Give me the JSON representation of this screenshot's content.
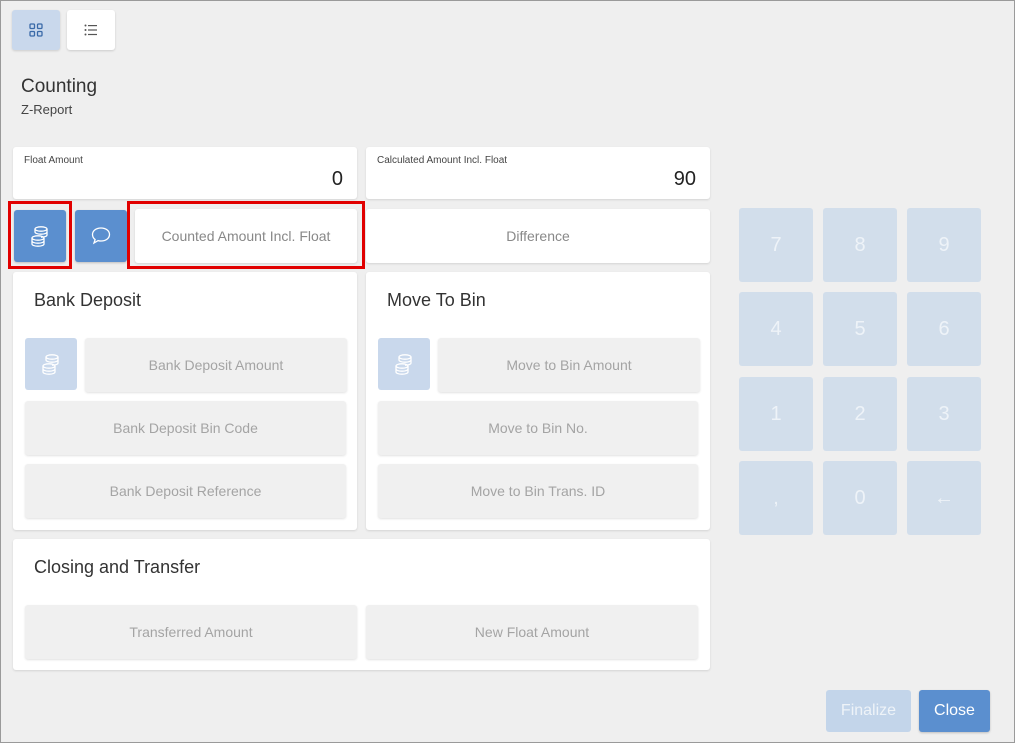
{
  "header": {
    "title": "Counting",
    "subtitle": "Z-Report"
  },
  "amounts": {
    "float_label": "Float Amount",
    "float_value": "0",
    "calculated_label": "Calculated Amount Incl. Float",
    "calculated_value": "90"
  },
  "counting": {
    "counted_label": "Counted Amount Incl. Float",
    "difference_label": "Difference"
  },
  "bank_deposit": {
    "title": "Bank Deposit",
    "amount_label": "Bank Deposit Amount",
    "bin_code_label": "Bank Deposit Bin Code",
    "reference_label": "Bank Deposit Reference"
  },
  "move_to_bin": {
    "title": "Move To Bin",
    "amount_label": "Move to Bin Amount",
    "bin_no_label": "Move to Bin No.",
    "trans_id_label": "Move to Bin Trans. ID"
  },
  "closing": {
    "title": "Closing and Transfer",
    "transferred_label": "Transferred Amount",
    "new_float_label": "New Float Amount"
  },
  "keypad": {
    "keys": [
      "7",
      "8",
      "9",
      "4",
      "5",
      "6",
      "1",
      "2",
      "3",
      ",",
      "0",
      "←"
    ]
  },
  "footer": {
    "finalize_label": "Finalize",
    "close_label": "Close"
  },
  "colors": {
    "accent": "#5b8fcf",
    "accent_disabled": "#c9d8ec",
    "highlight": "#e10000"
  }
}
